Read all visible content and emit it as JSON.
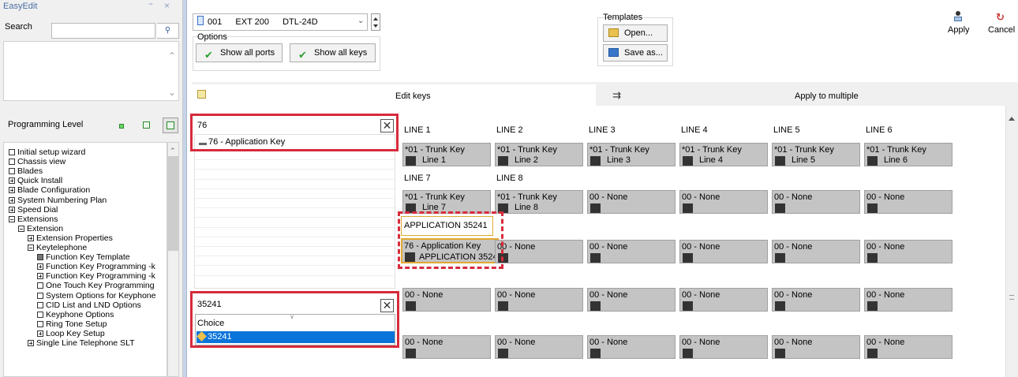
{
  "left_pane": {
    "title": "EasyEdit",
    "pin_glyph": "᪱",
    "close_glyph": "×",
    "search_label": "Search",
    "search_value": "",
    "programming_level_label": "Programming Level",
    "tree": [
      {
        "label": "Initial setup wizard",
        "state": "leaf",
        "indent": 0
      },
      {
        "label": "Chassis view",
        "state": "leaf",
        "indent": 0
      },
      {
        "label": "Blades",
        "state": "leaf",
        "indent": 0
      },
      {
        "label": "Quick Install",
        "state": "plus",
        "indent": 0
      },
      {
        "label": "Blade Configuration",
        "state": "plus",
        "indent": 0
      },
      {
        "label": "System Numbering Plan",
        "state": "plus",
        "indent": 0
      },
      {
        "label": "Speed Dial",
        "state": "plus",
        "indent": 0
      },
      {
        "label": "Extensions",
        "state": "minus",
        "indent": 0
      },
      {
        "label": "Extension",
        "state": "minus",
        "indent": 1
      },
      {
        "label": "Extension Properties",
        "state": "plus",
        "indent": 2
      },
      {
        "label": "Keytelephone",
        "state": "minus",
        "indent": 2
      },
      {
        "label": "Function Key Template",
        "state": "tpl",
        "indent": 3
      },
      {
        "label": "Function Key Programming -k",
        "state": "plus",
        "indent": 3
      },
      {
        "label": "Function Key Programming -k",
        "state": "plus",
        "indent": 3
      },
      {
        "label": "One Touch Key Programming",
        "state": "leaf",
        "indent": 3
      },
      {
        "label": "System Options for Keyphone",
        "state": "leaf",
        "indent": 3
      },
      {
        "label": "CID List and LND Options",
        "state": "leaf",
        "indent": 3
      },
      {
        "label": "Keyphone Options",
        "state": "leaf",
        "indent": 3
      },
      {
        "label": "Ring Tone Setup",
        "state": "leaf",
        "indent": 3
      },
      {
        "label": "Loop Key Setup",
        "state": "plus",
        "indent": 3
      },
      {
        "label": "Single Line Telephone SLT",
        "state": "plus",
        "indent": 2
      }
    ]
  },
  "toolbar": {
    "extension": {
      "port": "001",
      "ext": "200",
      "ext_label": "EXT 200",
      "type": "DTL-24D"
    },
    "options_label": "Options",
    "show_all_ports": "Show all ports",
    "show_all_keys": "Show all keys",
    "templates_label": "Templates",
    "open": "Open...",
    "save_as": "Save as...",
    "apply": "Apply",
    "cancel": "Cancel",
    "cancel_glyph": "↻"
  },
  "tabs": {
    "edit_keys": "Edit keys",
    "apply_multiple": "Apply to multiple",
    "apply_glyph": "⇉"
  },
  "key_search": {
    "value": "76",
    "clear_glyph": "✕",
    "result": "76 - Application Key"
  },
  "value_field": {
    "value": "35241",
    "clear_glyph": "✕",
    "choice_label": "Choice",
    "chevron_glyph": "∨",
    "selected": "35241"
  },
  "line_labels": [
    "LINE 1",
    "LINE 2",
    "LINE 3",
    "LINE 4",
    "LINE 5",
    "LINE 6",
    "LINE 7",
    "LINE 8"
  ],
  "app_label": "APPLICATION 35241",
  "keys": {
    "row1": [
      {
        "type": "*01 - Trunk Key",
        "label": "Line 1"
      },
      {
        "type": "*01 - Trunk Key",
        "label": "Line 2"
      },
      {
        "type": "*01 - Trunk Key",
        "label": "Line 3"
      },
      {
        "type": "*01 - Trunk Key",
        "label": "Line 4"
      },
      {
        "type": "*01 - Trunk Key",
        "label": "Line 5"
      },
      {
        "type": "*01 - Trunk Key",
        "label": "Line 6"
      }
    ],
    "row2": [
      {
        "type": "*01 - Trunk Key",
        "label": "Line 7"
      },
      {
        "type": "*01 - Trunk Key",
        "label": "Line 8"
      },
      {
        "type": "00 - None",
        "label": ""
      },
      {
        "type": "00 - None",
        "label": ""
      },
      {
        "type": "00 - None",
        "label": ""
      },
      {
        "type": "00 - None",
        "label": ""
      }
    ],
    "row3": [
      {
        "type": "76 - Application Key",
        "label": "APPLICATION 3524"
      },
      {
        "type": "00 - None",
        "label": ""
      },
      {
        "type": "00 - None",
        "label": ""
      },
      {
        "type": "00 - None",
        "label": ""
      },
      {
        "type": "00 - None",
        "label": ""
      },
      {
        "type": "00 - None",
        "label": ""
      }
    ],
    "row4": [
      {
        "type": "00 - None",
        "label": ""
      },
      {
        "type": "00 - None",
        "label": ""
      },
      {
        "type": "00 - None",
        "label": ""
      },
      {
        "type": "00 - None",
        "label": ""
      },
      {
        "type": "00 - None",
        "label": ""
      },
      {
        "type": "00 - None",
        "label": ""
      }
    ],
    "row5": [
      {
        "type": "00 - None",
        "label": ""
      },
      {
        "type": "00 - None",
        "label": ""
      },
      {
        "type": "00 - None",
        "label": ""
      },
      {
        "type": "00 - None",
        "label": ""
      },
      {
        "type": "00 - None",
        "label": ""
      },
      {
        "type": "00 - None",
        "label": ""
      }
    ]
  },
  "colors": {
    "highlight": "#d62b3b",
    "selection": "#0a74da",
    "key_bg": "#c4c4c4",
    "selected_key_border": "#e0a930"
  }
}
